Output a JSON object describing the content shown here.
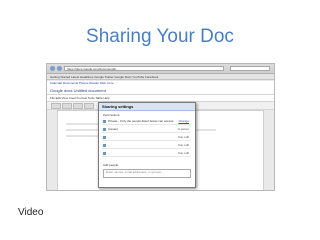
{
  "slide": {
    "title": "Sharing Your Doc",
    "footer": "Video"
  },
  "browser": {
    "url": "https://docs.google.com/document/d/...",
    "bookmarks": "Getting Started  Latest Headlines  Google  Twitter  Google Docs  YouTube  Facebook",
    "google_bar": "Calendar  Documents  Photos  Reader  Web  more",
    "nav_icons": [
      "back-icon",
      "forward-icon"
    ]
  },
  "docs": {
    "header": "Google docs   Untitled document",
    "menu": "File  Edit  View  Insert  Format  Tools  Table  Help"
  },
  "dialog": {
    "title": "Sharing settings",
    "permissions_label": "Permissions:",
    "rows": [
      {
        "label": "Private - Only the people listed below can access",
        "role": "",
        "action": "Change"
      },
      {
        "label": "(owner)",
        "role": "Is owner",
        "action": ""
      },
      {
        "label": "",
        "role": "Can edit",
        "action": ""
      },
      {
        "label": "",
        "role": "Can edit",
        "action": ""
      },
      {
        "label": "",
        "role": "Can edit",
        "action": ""
      }
    ],
    "add_label": "Add people:",
    "add_placeholder": "Enter names, email addresses, or groups..."
  }
}
